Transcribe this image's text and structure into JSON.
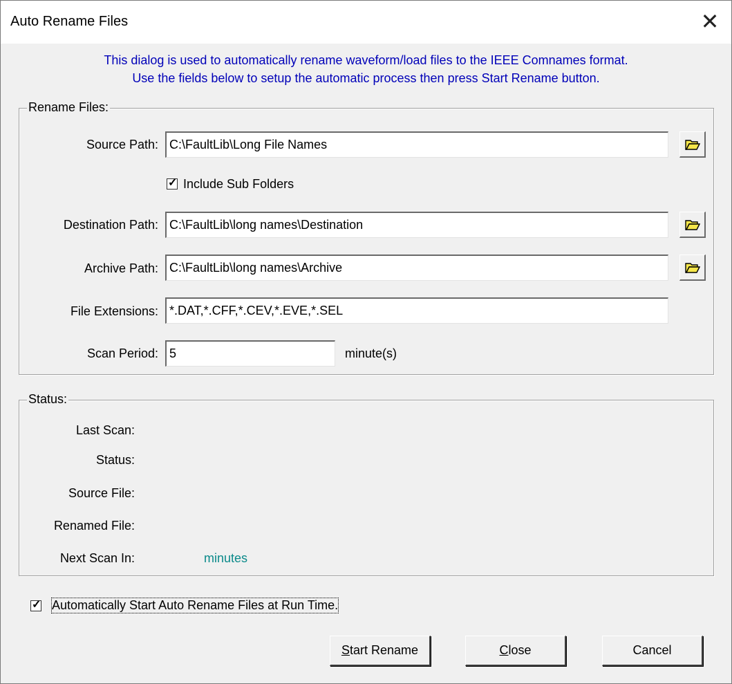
{
  "window": {
    "title": "Auto Rename Files",
    "close_glyph": "✕"
  },
  "intro": {
    "line1": "This dialog is used to automatically rename waveform/load files to the IEEE Comnames format.",
    "line2": "Use the fields below to setup the automatic process then press Start Rename button."
  },
  "rename_group": {
    "legend": "Rename Files:",
    "source_label": "Source Path:",
    "source_value": "C:\\FaultLib\\Long File Names",
    "include_sub_label": "Include Sub Folders",
    "include_sub_checked": true,
    "dest_label": "Destination Path:",
    "dest_value": "C:\\FaultLib\\long names\\Destination",
    "archive_label": "Archive Path:",
    "archive_value": "C:\\FaultLib\\long names\\Archive",
    "ext_label": "File Extensions:",
    "ext_value": "*.DAT,*.CFF,*.CEV,*.EVE,*.SEL",
    "scan_label": "Scan Period:",
    "scan_value": "5",
    "scan_unit": "minute(s)"
  },
  "status_group": {
    "legend": "Status:",
    "last_scan_label": "Last Scan:",
    "status_label": "Status:",
    "source_file_label": "Source File:",
    "renamed_file_label": "Renamed File:",
    "next_scan_label": "Next Scan In:",
    "next_scan_unit": "minutes"
  },
  "auto_start": {
    "label": "Automatically Start Auto Rename Files at Run Time.",
    "checked": true
  },
  "buttons": {
    "start_mnemonic": "S",
    "start_rest": "tart Rename",
    "close_mnemonic": "C",
    "close_rest": "lose",
    "cancel": "Cancel"
  },
  "colors": {
    "intro_text": "#0000b8",
    "minutes_text": "#0b8a8a",
    "folder_icon": "#f5e64a"
  }
}
